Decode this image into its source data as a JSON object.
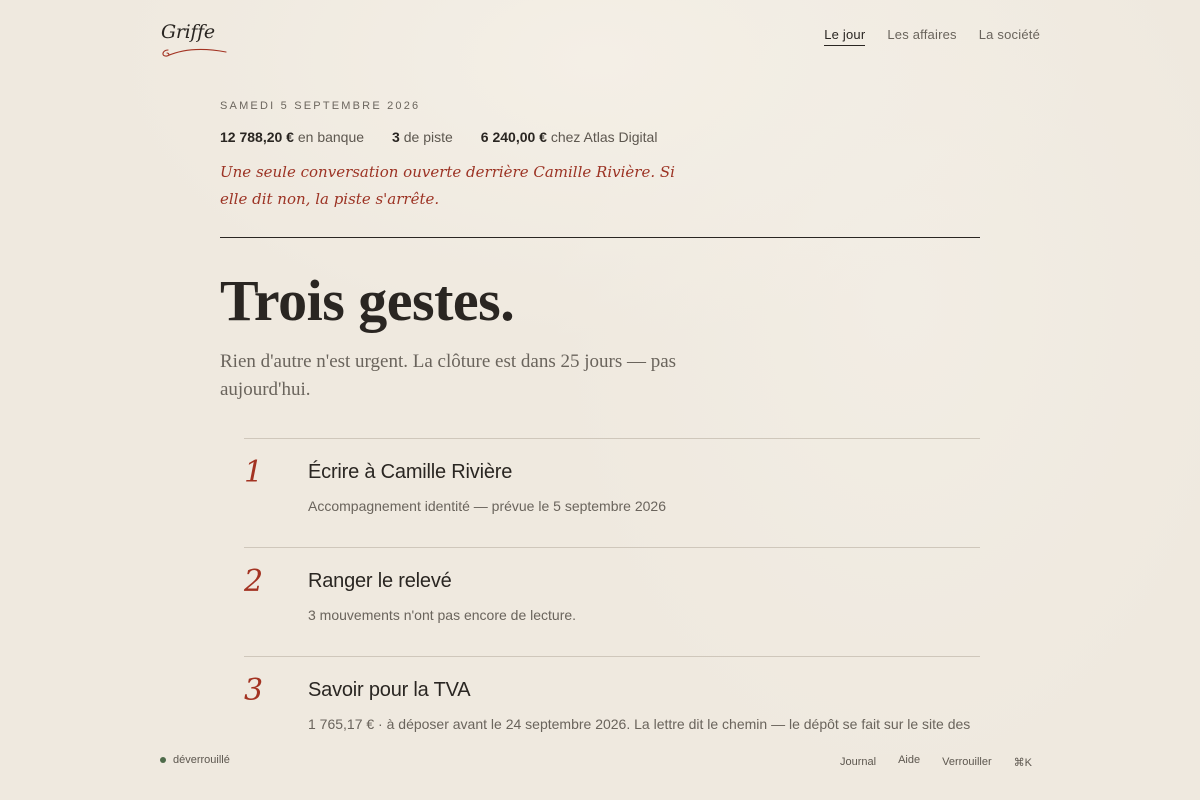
{
  "app": {
    "logo": "Griffe"
  },
  "nav": {
    "items": [
      {
        "label": "Le jour",
        "active": true
      },
      {
        "label": "Les affaires",
        "active": false
      },
      {
        "label": "La société",
        "active": false
      }
    ]
  },
  "summary": {
    "date": "SAMEDI 5 SEPTEMBRE 2026",
    "stats": [
      {
        "value": "12 788,20 €",
        "label": "en banque"
      },
      {
        "value": "3",
        "label": "de piste"
      },
      {
        "value": "6 240,00 €",
        "label": "chez Atlas Digital"
      }
    ],
    "note": "Une seule conversation ouverte derrière Camille Rivière. Si elle dit non, la piste s'arrête."
  },
  "main": {
    "headline": "Trois gestes.",
    "subtitle": "Rien d'autre n'est urgent. La clôture est dans 25 jours — pas aujourd'hui."
  },
  "tasks": [
    {
      "number": "1",
      "title": "Écrire à Camille Rivière",
      "description": "Accompagnement identité — prévue le 5 septembre 2026"
    },
    {
      "number": "2",
      "title": "Ranger le relevé",
      "description": "3 mouvements n'ont pas encore de lecture."
    },
    {
      "number": "3",
      "title": "Savoir pour la TVA",
      "description": "1 765,17 € · à déposer avant le 24 septembre 2026. La lettre dit le chemin — le dépôt se fait sur le site des"
    }
  ],
  "footer": {
    "status": "déverrouillé",
    "links": [
      "Journal",
      "Aide",
      "Verrouiller",
      "⌘K"
    ]
  },
  "colors": {
    "accent": "#a33322",
    "background": "#efe9df",
    "text": "#2a2622",
    "status_ok": "#4e6b4a"
  }
}
